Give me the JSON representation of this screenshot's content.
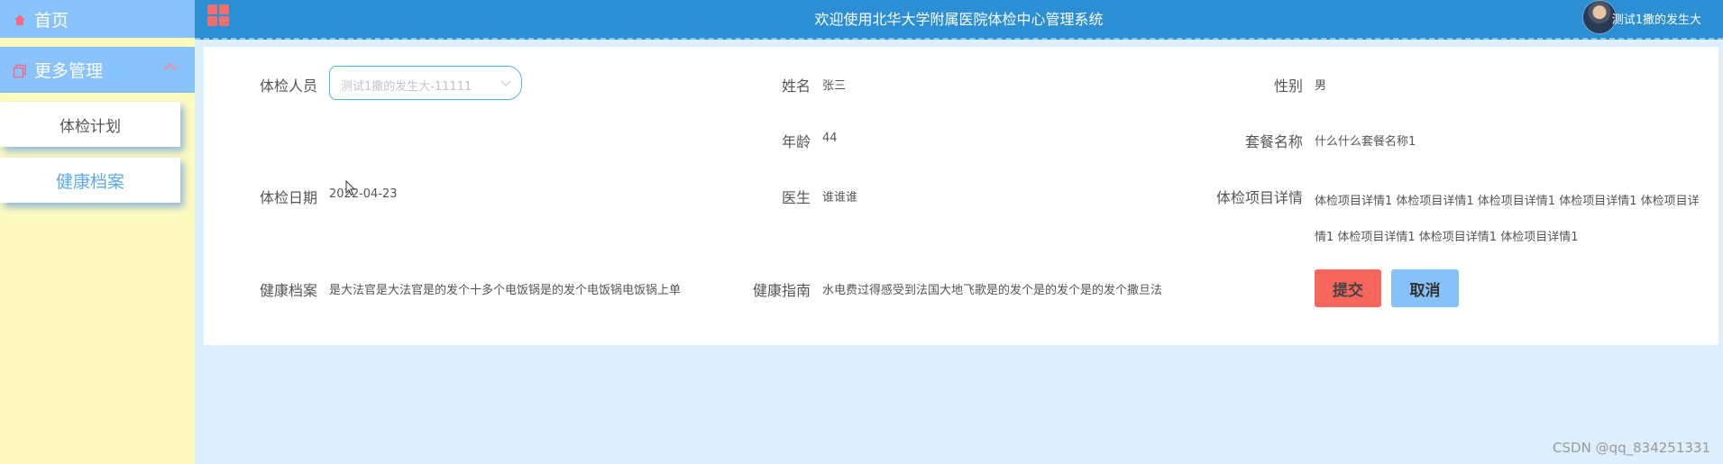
{
  "sidebar": {
    "home_label": "首页",
    "more_label": "更多管理",
    "items": [
      {
        "label": "体检计划"
      },
      {
        "label": "健康档案"
      }
    ]
  },
  "header": {
    "title": "欢迎使用北华大学附属医院体检中心管理系统",
    "username": "测试1撒的发生大"
  },
  "form": {
    "person_label": "体检人员",
    "person_select_value": "测试1撒的发生大-11111",
    "name_label": "姓名",
    "name_value": "张三",
    "gender_label": "性别",
    "gender_value": "男",
    "age_label": "年龄",
    "age_value": "44",
    "package_label": "套餐名称",
    "package_value": "什么什么套餐名称1",
    "date_label": "体检日期",
    "date_value": "2022-04-23",
    "doctor_label": "医生",
    "doctor_value": "谁谁谁",
    "detail_label": "体检项目详情",
    "detail_value": "体检项目详情1 体检项目详情1 体检项目详情1 体检项目详情1 体检项目详情1 体检项目详情1 体检项目详情1 体检项目详情1",
    "record_label": "健康档案",
    "record_value": "是大法官是大法官是的发个十多个电饭锅是的发个电饭锅电饭锅上单",
    "guide_label": "健康指南",
    "guide_value": "水电费过得感受到法国大地飞歌是的发个是的发个是的发个撒旦法",
    "submit_label": "提交",
    "cancel_label": "取消"
  },
  "watermark": "CSDN @qq_834251331",
  "colors": {
    "header_bg": "#2c8fd3",
    "sidebar_bg": "#fffbc0",
    "menu_bg": "#89c3fb",
    "submit_bg": "#f8665c",
    "cancel_bg": "#86c1f7",
    "content_bg": "#ddeefc"
  }
}
